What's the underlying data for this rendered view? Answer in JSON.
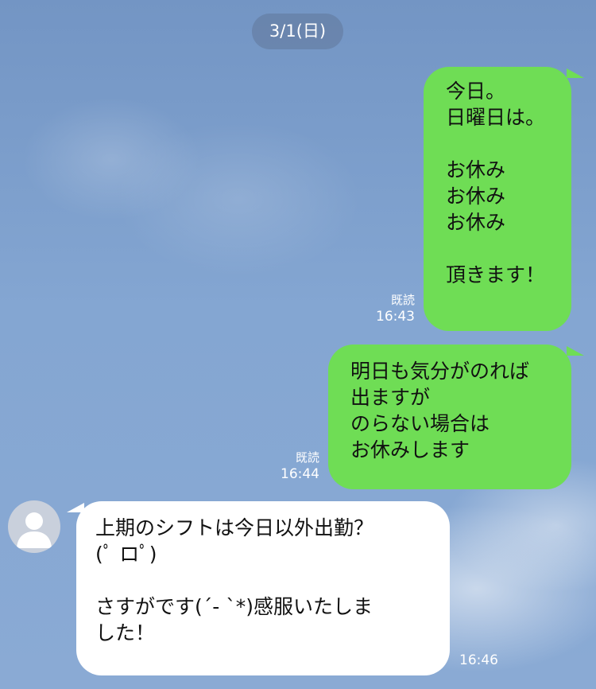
{
  "date_separator": "3/1(日)",
  "messages": [
    {
      "direction": "outgoing",
      "text": "今日。\n日曜日は。\n\nお休み\nお休み\nお休み\n\n頂きます！",
      "read_label": "既読",
      "time": "16:43"
    },
    {
      "direction": "outgoing",
      "text": "明日も気分がのれば\n出ますが\nのらない場合は\nお休みします",
      "read_label": "既読",
      "time": "16:44"
    },
    {
      "direction": "incoming",
      "sender_avatar": "default-user-avatar",
      "text": "上期のシフトは今日以外出勤？\n(ﾟ ロﾟ)\n\nさすがです(´- `*)感服いたしま\nした！",
      "time": "16:46"
    }
  ],
  "colors": {
    "outgoing_bubble": "#6fdd55",
    "incoming_bubble": "#ffffff",
    "background": "#7ea0cd",
    "meta_text": "#ffffff"
  }
}
